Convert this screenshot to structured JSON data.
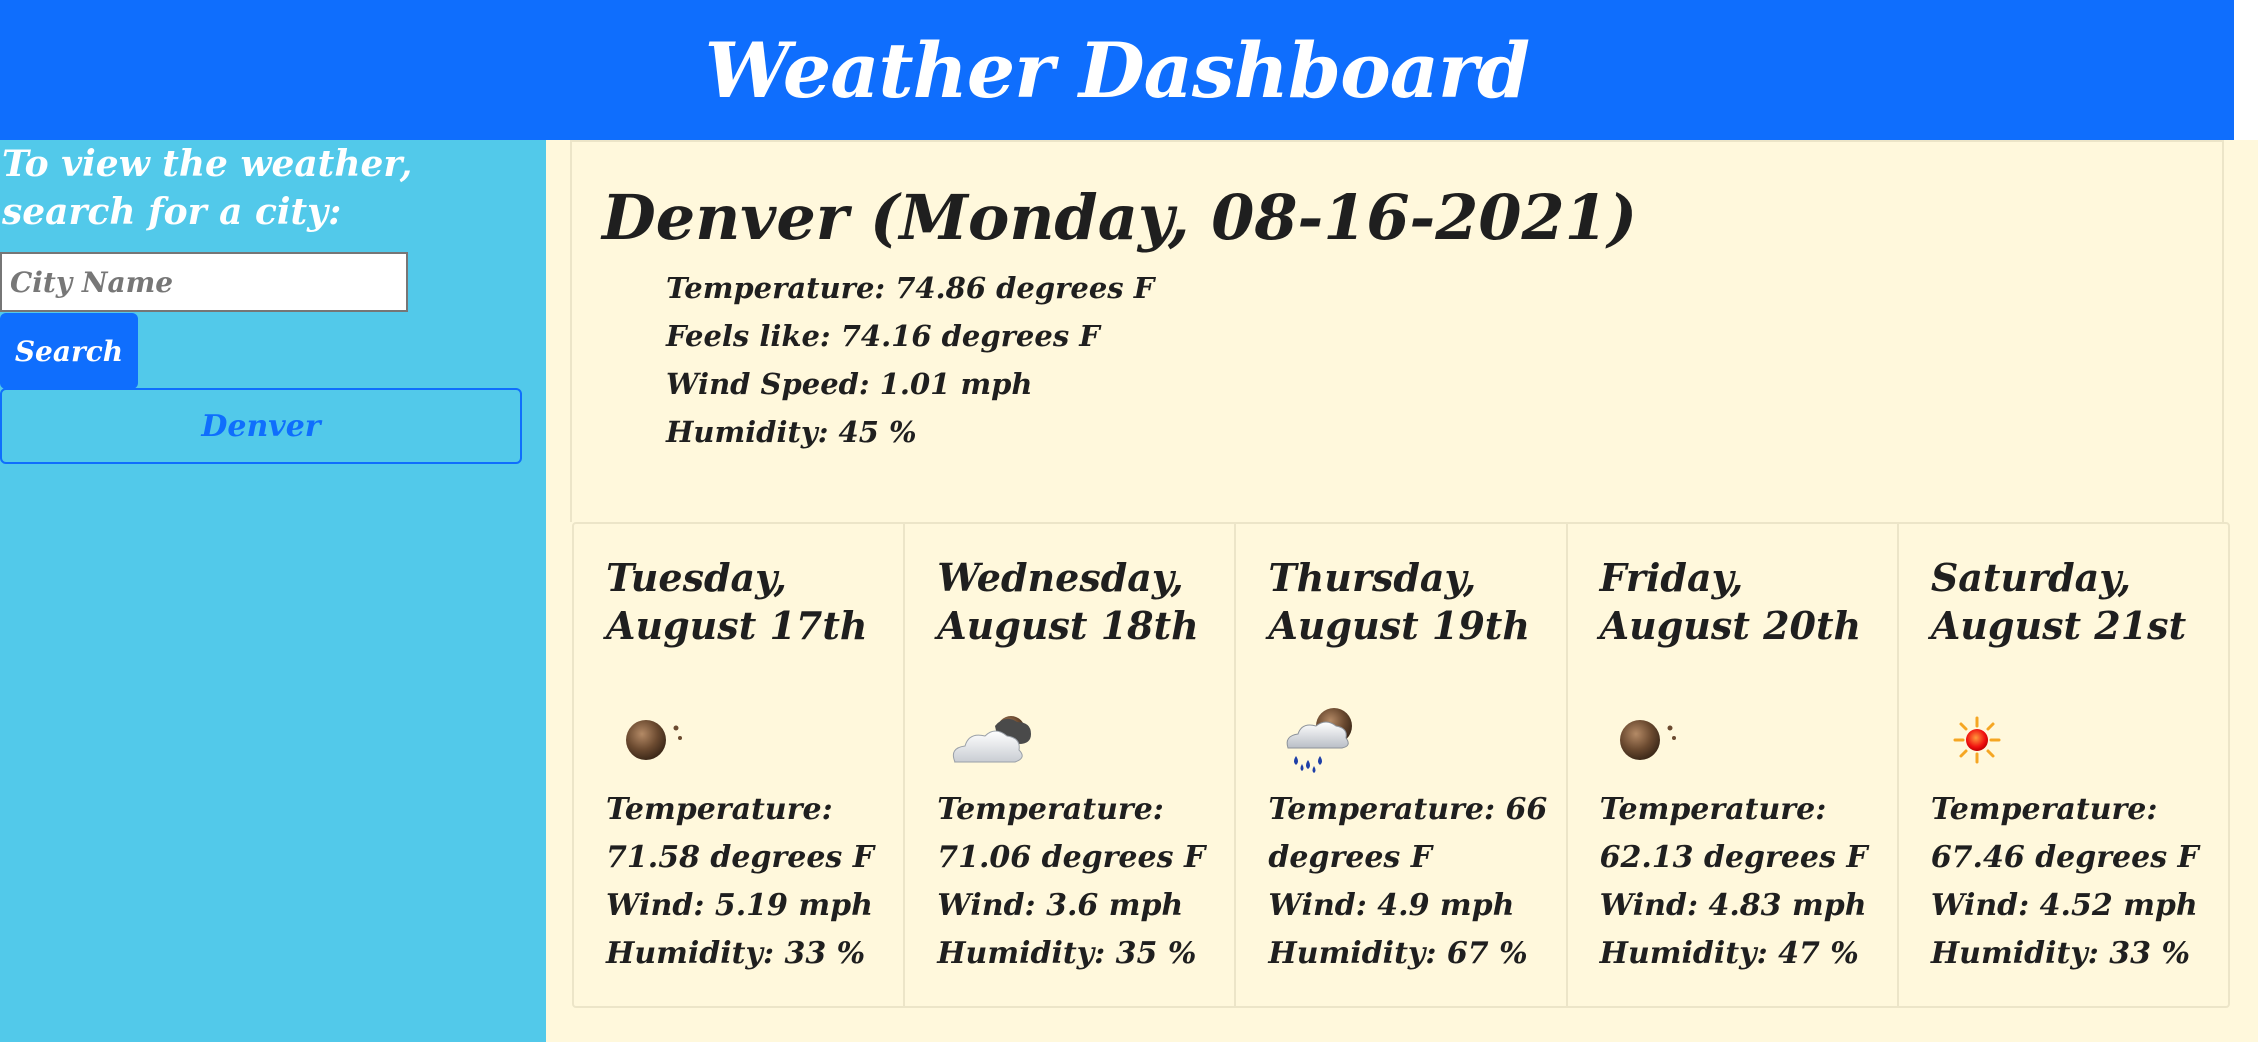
{
  "header": {
    "title": "Weather Dashboard"
  },
  "sidebar": {
    "prompt": "To view the weather, search for a city:",
    "search_placeholder": "City Name",
    "search_value": "",
    "search_button": "Search",
    "history": [
      "Denver"
    ]
  },
  "current": {
    "title": "Denver (Monday, 08-16-2021)",
    "temperature": "Temperature: 74.86 degrees F",
    "feels_like": "Feels like: 74.16 degrees F",
    "wind": "Wind Speed: 1.01 mph",
    "humidity": "Humidity: 45 %"
  },
  "forecast": [
    {
      "date": "Tuesday, August 17th",
      "icon": "night-clear-moon-icon",
      "temperature": "Temperature: 71.58 degrees F",
      "wind": "Wind: 5.19 mph",
      "humidity": "Humidity: 33 %"
    },
    {
      "date": "Wednesday, August 18th",
      "icon": "night-cloudy-icon",
      "temperature": "Temperature: 71.06 degrees F",
      "wind": "Wind: 3.6 mph",
      "humidity": "Humidity: 35 %"
    },
    {
      "date": "Thursday, August 19th",
      "icon": "night-rain-icon",
      "temperature": "Temperature: 66 degrees F",
      "wind": "Wind: 4.9 mph",
      "humidity": "Humidity: 67 %"
    },
    {
      "date": "Friday, August 20th",
      "icon": "night-clear-moon-icon",
      "temperature": "Temperature: 62.13 degrees F",
      "wind": "Wind: 4.83 mph",
      "humidity": "Humidity: 47 %"
    },
    {
      "date": "Saturday, August 21st",
      "icon": "sun-icon",
      "temperature": "Temperature: 67.46 degrees F",
      "wind": "Wind: 4.52 mph",
      "humidity": "Humidity: 33 %"
    }
  ]
}
